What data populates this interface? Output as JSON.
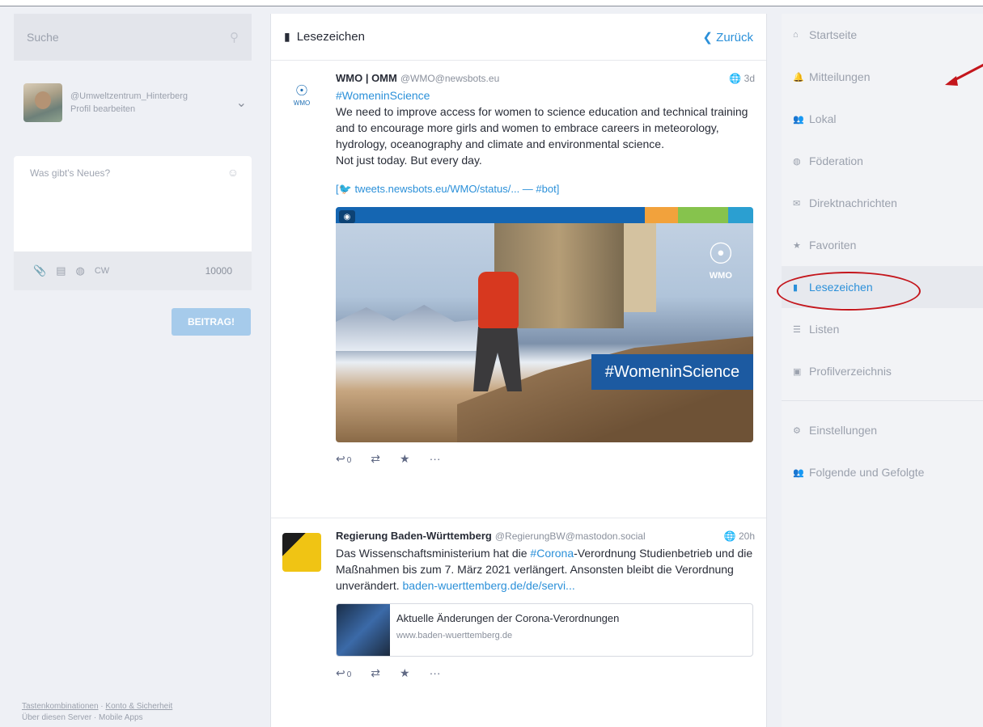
{
  "search": {
    "placeholder": "Suche"
  },
  "account": {
    "handle": "@Umweltzentrum_Hinterberg",
    "edit": "Profil bearbeiten"
  },
  "composer": {
    "placeholder": "Was gibt's Neues?",
    "cw": "CW",
    "count": "10000",
    "publish": "BEITRAG!"
  },
  "footer": {
    "link1": "Tastenkombinationen",
    "sep": " · ",
    "link2": "Konto & Sicherheit",
    "line2": "Über diesen Server · Mobile Apps"
  },
  "column": {
    "title": "Lesezeichen",
    "back": "Zurück"
  },
  "statuses": [
    {
      "name": "WMO | OMM",
      "acct": "@WMO@newsbots.eu",
      "time": "3d",
      "hashtag": "#WomeninScience",
      "text": "We need to improve access for women to science education and technical training and to encourage more girls and women to embrace careers in meteorology, hydrology, oceanography and climate and environmental science.",
      "text2": "Not just today. But every day.",
      "link": "tweets.newsbots.eu/WMO/status/... — #bot",
      "media_tag": "#WomeninScience",
      "media_logo": "WMO",
      "replies": "0"
    },
    {
      "name": "Regierung Baden-Württemberg",
      "acct": "@RegierungBW@mastodon.social",
      "time": "20h",
      "text_a": "Das Wissenschaftsministerium hat die ",
      "tag": "#Corona",
      "text_b": "-Verordnung Studienbetrieb und die Maßnahmen bis zum 7. März 2021 verlängert. Ansonsten bleibt die Verordnung unverändert. ",
      "link": "baden-wuerttemberg.de/de/servi...",
      "card_title": "Aktuelle Änderungen der Corona-Verordnungen",
      "card_url": "www.baden-wuerttemberg.de",
      "replies": "0"
    }
  ],
  "nav": {
    "home": "Startseite",
    "notifications": "Mitteilungen",
    "local": "Lokal",
    "federation": "Föderation",
    "direct": "Direktnachrichten",
    "favourites": "Favoriten",
    "bookmarks": "Lesezeichen",
    "lists": "Listen",
    "directory": "Profilverzeichnis",
    "settings": "Einstellungen",
    "follows": "Folgende und Gefolgte"
  },
  "colors": {
    "accent": "#2b90d9",
    "annotation": "#c4161c"
  }
}
